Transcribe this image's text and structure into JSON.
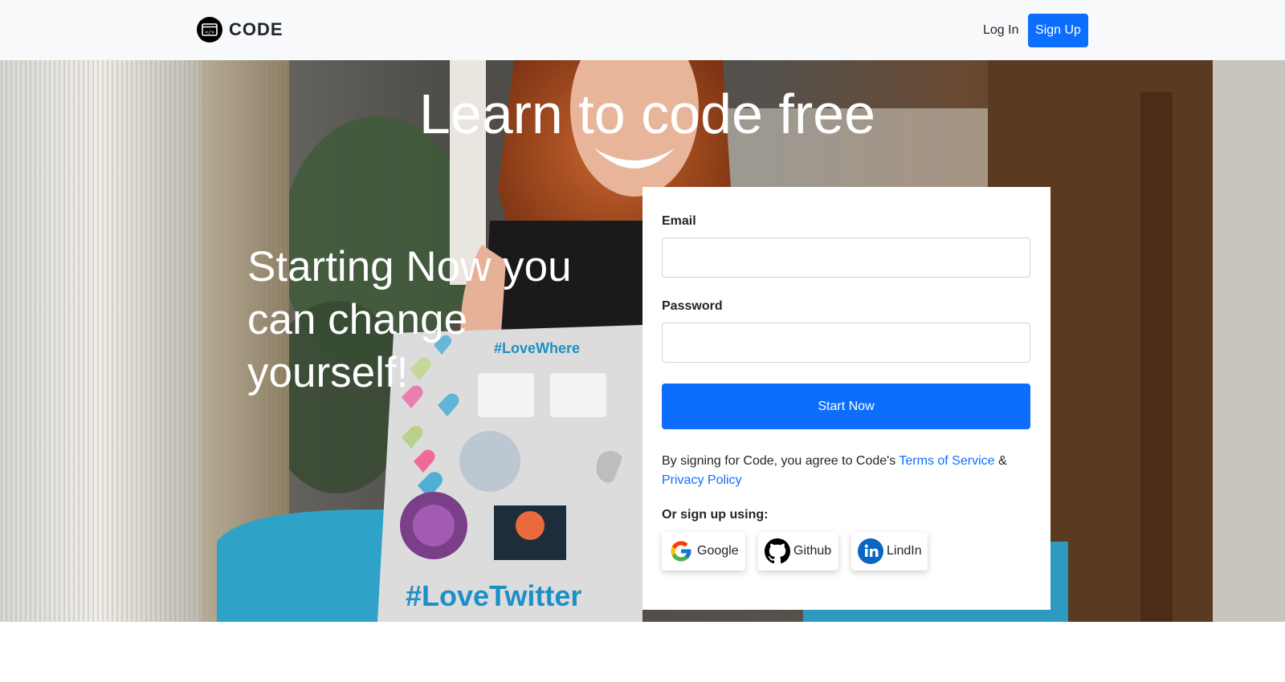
{
  "navbar": {
    "brand": "CODE",
    "brand_icon": "code-window-icon",
    "login_label": "Log In",
    "signup_label": "Sign Up",
    "accent": "#0d6efd"
  },
  "hero": {
    "title": "Learn to code free",
    "subtitle": "Starting Now you can change yourself!"
  },
  "form": {
    "email_label": "Email",
    "email_value": "",
    "password_label": "Password",
    "password_value": "",
    "submit_label": "Start Now",
    "terms_prefix": "By signing for Code, you agree to Code's ",
    "terms_link": "Terms of Service",
    "terms_amp": " &",
    "privacy_link": "Privacy Policy",
    "or_label": "Or sign up using:",
    "social": [
      {
        "label": "Google",
        "icon": "google-icon"
      },
      {
        "label": "Github",
        "icon": "github-icon"
      },
      {
        "label": "LindIn",
        "icon": "linkedin-icon"
      }
    ]
  }
}
